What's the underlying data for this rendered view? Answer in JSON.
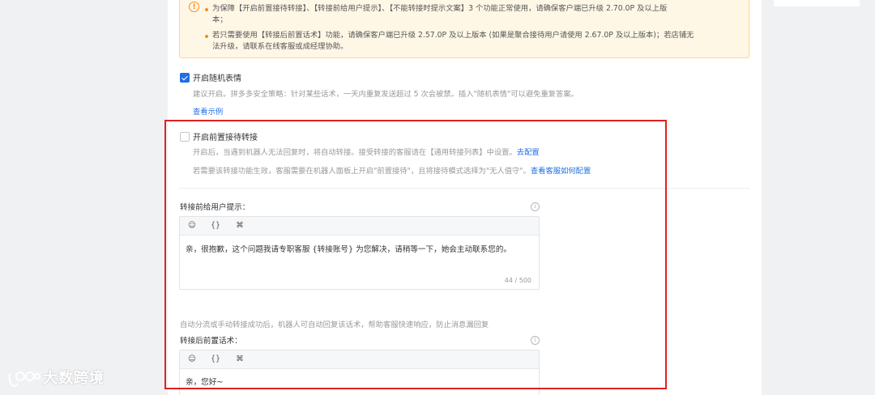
{
  "notice": {
    "line1": "为保障【开启前置接待转接】、【转接前给用户提示】、【不能转接时提示文案】3 个功能正常使用，请确保客户端已升级 2.70.0P 及以上版",
    "line1b": "本；",
    "line2": "若只需要使用【转接后前置话术】功能，请确保客户端已升级 2.57.0P 及以上版本 (如果是聚合接待用户请使用 2.67.0P 及以上版本)；若店铺无",
    "line2b": "法升级，请联系在线客服或成经理协助。",
    "accent": "#fa8c16",
    "background": "#fff7e6"
  },
  "random_emoji": {
    "checked": true,
    "label": "开启随机表情",
    "hint": "建议开启。拼多多安全策略：针对某些话术，一天内重复发送超过 5 次会被禁。插入\"随机表情\"可以避免重复答案。",
    "example_link": "查看示例"
  },
  "pre_transfer": {
    "checked": false,
    "label": "开启前置接待转接",
    "hint1": "开启后，当遇到机器人无法回复时，将自动转接。接受转接的客服请在【通用转接列表】中设置。",
    "hint1_link": "去配置",
    "hint2": "若需要该转接功能生效，客服需要在机器人面板上开启\"前置接待\"，且将接待模式选择为\"无人值守\"。",
    "hint2_link": "查看客服如何配置"
  },
  "before_prompt": {
    "label": "转接前给用户提示：",
    "toolbar": [
      "smile-icon",
      "braces-icon",
      "variable-icon"
    ],
    "toolbar_glyphs": [
      "☺",
      "{}",
      "⌘"
    ],
    "text": "亲，很抱歉，这个问题我请专职客服 {转接账号} 为您解决，请稍等一下，她会主动联系您的。",
    "count": "44 / 500"
  },
  "after_script": {
    "desc": "自动分流或手动转接成功后，机器人可自动回复该话术，帮助客服快速响应，防止消息漏回复",
    "label": "转接后前置话术：",
    "text": "亲，您好~"
  },
  "watermark": {
    "text": "大数跨境"
  },
  "colors": {
    "highlight_border": "#e02020",
    "link": "#1f6fe5",
    "checkbox": "#1f6fe5"
  }
}
